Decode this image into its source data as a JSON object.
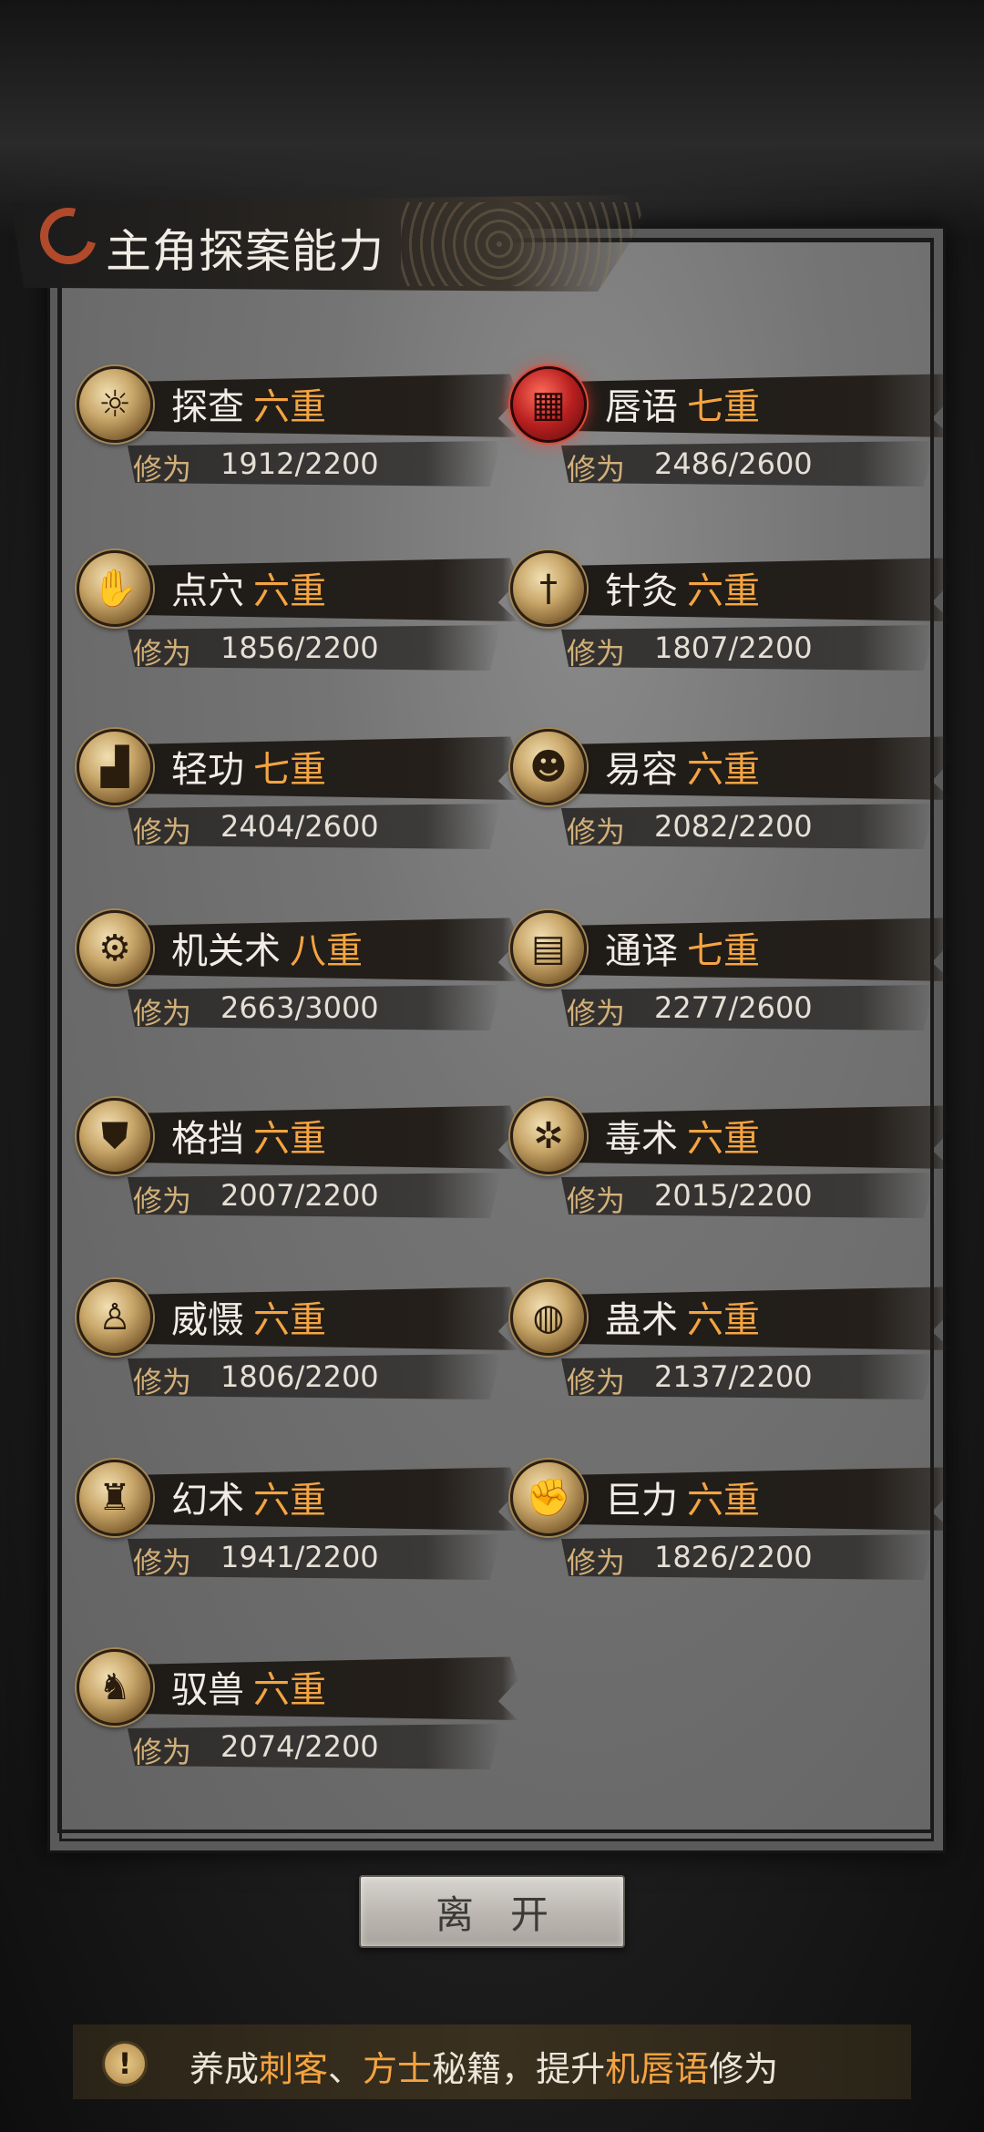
{
  "title": "主角探案能力",
  "cultivation_label": "修为",
  "skills": [
    {
      "name": "探查",
      "level": "六重",
      "current": 1912,
      "max": 2200,
      "text": "1912/2200",
      "icon": "lantern-icon",
      "highlight": false
    },
    {
      "name": "唇语",
      "level": "七重",
      "current": 2486,
      "max": 2600,
      "text": "2486/2600",
      "icon": "red-lantern-icon",
      "highlight": true
    },
    {
      "name": "点穴",
      "level": "六重",
      "current": 1856,
      "max": 2200,
      "text": "1856/2200",
      "icon": "finger-strike-icon",
      "highlight": false
    },
    {
      "name": "针灸",
      "level": "六重",
      "current": 1807,
      "max": 2200,
      "text": "1807/2200",
      "icon": "needle-icon",
      "highlight": false
    },
    {
      "name": "轻功",
      "level": "七重",
      "current": 2404,
      "max": 2600,
      "text": "2404/2600",
      "icon": "boot-icon",
      "highlight": false
    },
    {
      "name": "易容",
      "level": "六重",
      "current": 2082,
      "max": 2200,
      "text": "2082/2200",
      "icon": "mask-icon",
      "highlight": false
    },
    {
      "name": "机关术",
      "level": "八重",
      "current": 2663,
      "max": 3000,
      "text": "2663/3000",
      "icon": "gear-icon",
      "highlight": false
    },
    {
      "name": "通译",
      "level": "七重",
      "current": 2277,
      "max": 2600,
      "text": "2277/2600",
      "icon": "scroll-icon",
      "highlight": false
    },
    {
      "name": "格挡",
      "level": "六重",
      "current": 2007,
      "max": 2200,
      "text": "2007/2200",
      "icon": "shield-icon",
      "highlight": false
    },
    {
      "name": "毒术",
      "level": "六重",
      "current": 2015,
      "max": 2200,
      "text": "2015/2200",
      "icon": "spider-icon",
      "highlight": false
    },
    {
      "name": "威慑",
      "level": "六重",
      "current": 1806,
      "max": 2200,
      "text": "1806/2200",
      "icon": "warrior-icon",
      "highlight": false
    },
    {
      "name": "蛊术",
      "level": "六重",
      "current": 2137,
      "max": 2200,
      "text": "2137/2200",
      "icon": "worm-icon",
      "highlight": false
    },
    {
      "name": "幻术",
      "level": "六重",
      "current": 1941,
      "max": 2200,
      "text": "1941/2200",
      "icon": "hooded-figure-icon",
      "highlight": false
    },
    {
      "name": "巨力",
      "level": "六重",
      "current": 1826,
      "max": 2200,
      "text": "1826/2200",
      "icon": "fist-icon",
      "highlight": false
    },
    {
      "name": "驭兽",
      "level": "六重",
      "current": 2074,
      "max": 2200,
      "text": "2074/2200",
      "icon": "wolf-icon",
      "highlight": false
    }
  ],
  "leave_button": "离开",
  "tip": {
    "icon": "exclamation-icon",
    "parts": [
      {
        "text": "养成",
        "hl": false
      },
      {
        "text": "刺客",
        "hl": true
      },
      {
        "text": "、",
        "hl": false
      },
      {
        "text": "方士",
        "hl": true
      },
      {
        "text": "秘籍，提升",
        "hl": false
      },
      {
        "text": "机唇语",
        "hl": true
      },
      {
        "text": "修为",
        "hl": false
      }
    ]
  },
  "colors": {
    "level_accent": "#f5a441",
    "cultivation_label": "#d2b07a",
    "red_emblem": "#b81f1f"
  }
}
